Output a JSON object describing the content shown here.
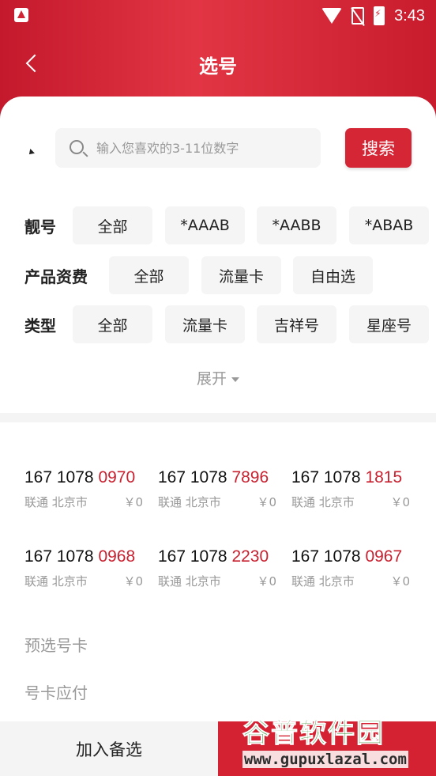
{
  "status_bar": {
    "time": "3:43",
    "icons": [
      "app-icon",
      "wifi-icon",
      "no-sim-icon",
      "battery-charging-icon"
    ]
  },
  "nav": {
    "title": "选号",
    "back_icon": "chevron-left-icon"
  },
  "search": {
    "placeholder": "输入您喜欢的3-11位数字",
    "button_label": "搜索"
  },
  "filters": [
    {
      "label": "靓号",
      "chips": [
        "全部",
        "*AAAB",
        "*AABB",
        "*ABAB"
      ]
    },
    {
      "label": "产品资费",
      "chips": [
        "全部",
        "流量卡",
        "自由选"
      ]
    },
    {
      "label": "类型",
      "chips": [
        "全部",
        "流量卡",
        "吉祥号",
        "星座号"
      ]
    }
  ],
  "expand_label": "展开",
  "numbers": [
    {
      "prefix": "167 1078 ",
      "tail": "0970",
      "carrier": "联通 北京市",
      "price": "￥0"
    },
    {
      "prefix": "167 1078 ",
      "tail": "7896",
      "carrier": "联通 北京市",
      "price": "￥0"
    },
    {
      "prefix": "167 1078 ",
      "tail": "1815",
      "carrier": "联通 北京市",
      "price": "￥0"
    },
    {
      "prefix": "167 1078 ",
      "tail": "0968",
      "carrier": "联通 北京市",
      "price": "￥0"
    },
    {
      "prefix": "167 1078 ",
      "tail": "2230",
      "carrier": "联通 北京市",
      "price": "￥0"
    },
    {
      "prefix": "167 1078 ",
      "tail": "0967",
      "carrier": "联通 北京市",
      "price": "￥0"
    }
  ],
  "summary": {
    "preselected_label": "预选号卡",
    "payable_label": "号卡应付"
  },
  "bottom_bar": {
    "add_label": "加入备选"
  },
  "watermark": {
    "title": "谷普软件园",
    "url": "www.gupuxlazal.com"
  },
  "colors": {
    "brand_red": "#d52636",
    "number_tail": "#c8202f",
    "watermark_green": "#2f8d2a"
  }
}
